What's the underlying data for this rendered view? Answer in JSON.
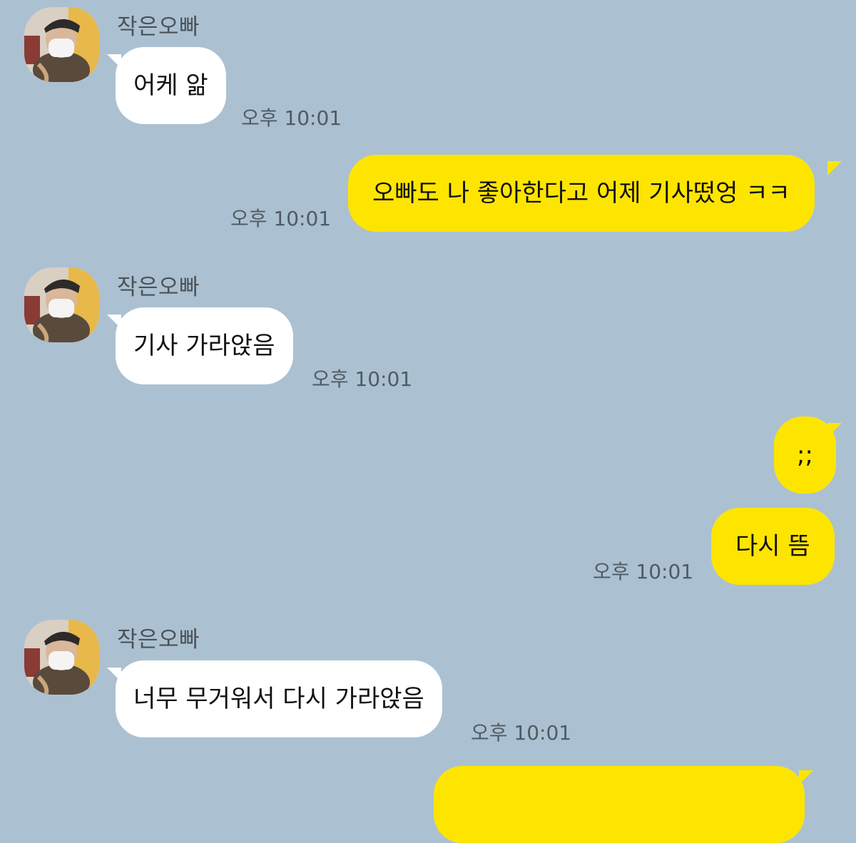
{
  "chat": {
    "sender_name": "작은오빠",
    "messages": [
      {
        "from": "them",
        "text": "어케 앎",
        "time": "오후 10:01"
      },
      {
        "from": "me",
        "text": "오빠도 나 좋아한다고 어제 기사떴엉 ㅋㅋ",
        "time": "오후 10:01"
      },
      {
        "from": "them",
        "text": "기사 가라앉음",
        "time": "오후 10:01"
      },
      {
        "from": "me",
        "text": ";;"
      },
      {
        "from": "me",
        "text": "다시 뜸",
        "time": "오후 10:01"
      },
      {
        "from": "them",
        "text": "너무 무거워서 다시 가라앉음",
        "time": "오후 10:01"
      }
    ]
  },
  "colors": {
    "background": "#abc1d1",
    "incoming_bubble": "#ffffff",
    "outgoing_bubble": "#fee500",
    "timestamp": "#515a62"
  }
}
